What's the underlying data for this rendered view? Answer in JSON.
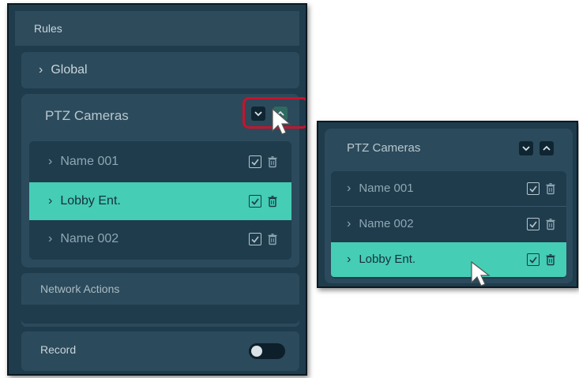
{
  "left_panel": {
    "header": "Rules",
    "global": {
      "label": "Global",
      "expanded": false
    },
    "ptz": {
      "title": "PTZ Cameras",
      "items": [
        {
          "label": "Name 001",
          "checked": true,
          "active": false
        },
        {
          "label": "Lobby Ent.",
          "checked": true,
          "active": true
        },
        {
          "label": "Name 002",
          "checked": true,
          "active": false
        }
      ]
    },
    "network_actions": {
      "label": "Network Actions"
    },
    "record": {
      "label": "Record",
      "on": false
    }
  },
  "right_panel": {
    "ptz": {
      "title": "PTZ Cameras",
      "items": [
        {
          "label": "Name 001",
          "checked": true,
          "active": false
        },
        {
          "label": "Name 002",
          "checked": true,
          "active": false
        },
        {
          "label": "Lobby Ent.",
          "checked": true,
          "active": true
        }
      ]
    }
  },
  "colors": {
    "panel_bg": "#1f3c4d",
    "card_bg": "#2b4a5b",
    "active_row": "#45cdb5",
    "highlight": "#c8132b"
  },
  "icons": [
    "chevron-right-icon",
    "chevron-down-icon",
    "chevron-up-icon",
    "checkbox-icon",
    "trash-icon",
    "mouse-cursor-icon"
  ]
}
